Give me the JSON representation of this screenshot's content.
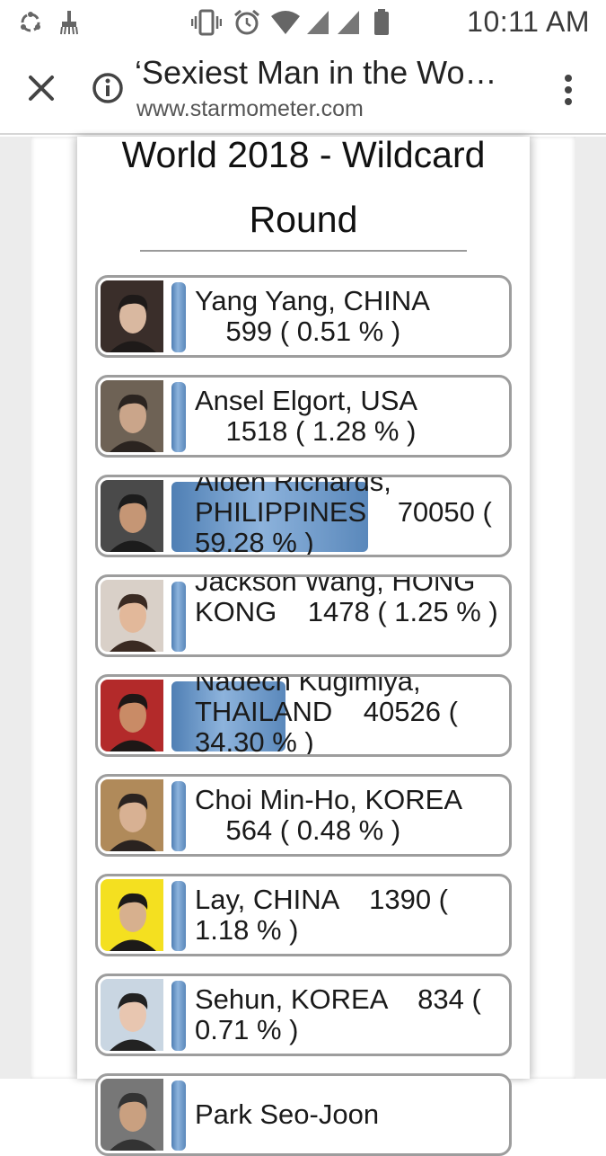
{
  "status_bar": {
    "time": "10:11 AM",
    "left_icons": [
      "sync-icon",
      "cleaner-icon"
    ],
    "right_icons": [
      "vibrate-icon",
      "alarm-icon",
      "wifi-icon",
      "signal-icon",
      "signal-icon",
      "battery-icon"
    ]
  },
  "browser": {
    "title": "‘Sexiest Man in the Wo…",
    "url": "www.starmometer.com",
    "icons": [
      "close-icon",
      "info-icon",
      "more-vert-icon"
    ]
  },
  "poll": {
    "title": "World 2018 - Wildcard Round",
    "candidates": [
      {
        "name": "Yang Yang, CHINA",
        "votes": "599",
        "percent": "0.51 %",
        "text": "Yang Yang, CHINA\n    599 ( 0.51 % )",
        "share": 0.51
      },
      {
        "name": "Ansel Elgort, USA",
        "votes": "1518",
        "percent": "1.28 %",
        "text": "Ansel Elgort, USA\n    1518 ( 1.28 % )",
        "share": 1.28
      },
      {
        "name": "Alden Richards, PHILIPPINES",
        "votes": "70050",
        "percent": "59.28 %",
        "text": "Alden Richards, PHILIPPINES    70050 ( 59.28 % )",
        "share": 59.28
      },
      {
        "name": "Jackson Wang, HONG KONG",
        "votes": "1478",
        "percent": "1.25 %",
        "text": "Jackson Wang, HONG KONG    1478 ( 1.25 % )",
        "share": 1.25
      },
      {
        "name": "Nadech Kugimiya, THAILAND",
        "votes": "40526",
        "percent": "34.30 %",
        "text": "Nadech Kugimiya, THAILAND    40526 ( 34.30 % )",
        "share": 34.3
      },
      {
        "name": "Choi Min-Ho, KOREA",
        "votes": "564",
        "percent": "0.48 %",
        "text": "Choi Min-Ho, KOREA\n    564 ( 0.48 % )",
        "share": 0.48
      },
      {
        "name": "Lay, CHINA",
        "votes": "1390",
        "percent": "1.18 %",
        "text": "Lay, CHINA    1390 ( 1.18 % )",
        "share": 1.18
      },
      {
        "name": "Sehun, KOREA",
        "votes": "834",
        "percent": "0.71 %",
        "text": "Sehun, KOREA    834 ( 0.71 % )",
        "share": 0.71
      },
      {
        "name": "Park Seo-Joon",
        "votes": "",
        "percent": "",
        "text": "Park Seo-Joon",
        "share": 0
      }
    ]
  }
}
